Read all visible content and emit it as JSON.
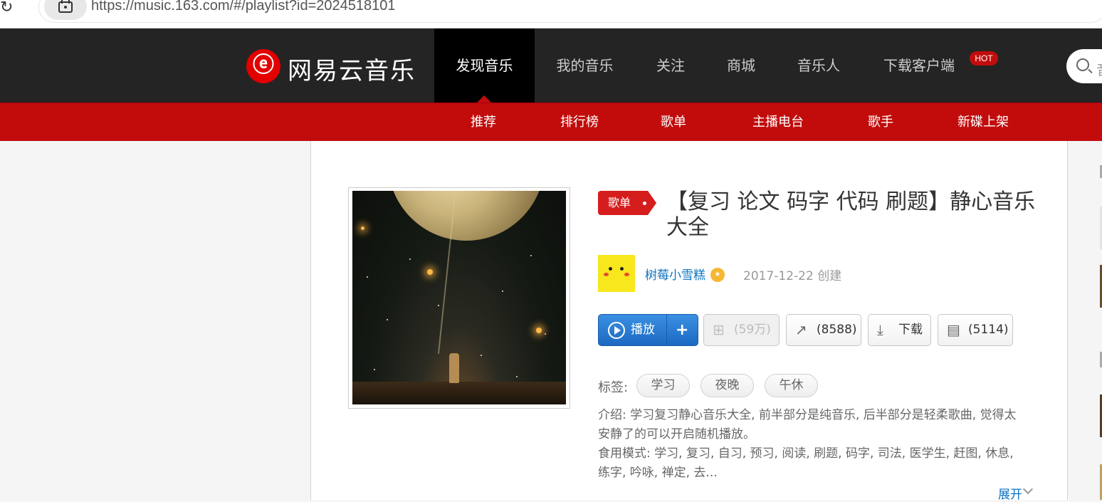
{
  "browser": {
    "url": "https://music.163.com/#/playlist?id=2024518101"
  },
  "header": {
    "logo_text": "网易云音乐",
    "nav": [
      "发现音乐",
      "我的音乐",
      "关注",
      "商城",
      "音乐人",
      "下载客户端"
    ],
    "hot_badge": "HOT",
    "search_placeholder": "音"
  },
  "subnav": [
    "推荐",
    "排行榜",
    "歌单",
    "主播电台",
    "歌手",
    "新碟上架"
  ],
  "playlist": {
    "badge": "歌单",
    "title": "【复习 论文 码字 代码 刷题】静心音乐大全",
    "creator": "树莓小雪糕",
    "created": "2017-12-22 创建",
    "buttons": {
      "play": "播放",
      "add": "+",
      "collect": "(59万)",
      "share": "(8588)",
      "download": "下载",
      "comment": "(5114)"
    },
    "tags_label": "标签:",
    "tags": [
      "学习",
      "夜晚",
      "午休"
    ],
    "desc_line1": "介绍: 学习复习静心音乐大全, 前半部分是纯音乐, 后半部分是轻柔歌曲, 觉得太安静了的可以开启随机播放。",
    "desc_line2": "食用模式: 学习, 复习, 自习, 预习, 阅读, 刷题, 码字, 司法, 医学生, 赶图, 休息, 练字, 吟咏, 禅定, 去...",
    "expand": "展开"
  },
  "colors": {
    "brand_red": "#c20c0c",
    "topbar_bg": "#242424",
    "link_blue": "#0c73c2",
    "play_blue": "#2b7cd3"
  }
}
